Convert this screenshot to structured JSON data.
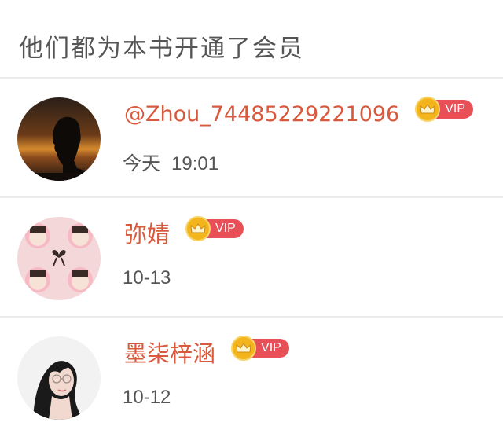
{
  "header": {
    "title": "他们都为本书开通了会员"
  },
  "vip_label": "VIP",
  "colors": {
    "name": "#d9593d",
    "vip_badge": "#e84f57",
    "crown": "#f3b51b",
    "divider": "#ececec"
  },
  "members": [
    {
      "name": "@Zhou_74485229221096",
      "time_day": "今天",
      "time": "19:01",
      "vip": true,
      "avatar_icon": "silhouette-sunset-avatar"
    },
    {
      "name": "弥婧",
      "time": "10-13",
      "vip": true,
      "avatar_icon": "collage-photo-avatar"
    },
    {
      "name": "墨柒梓涵",
      "time": "10-12",
      "vip": true,
      "avatar_icon": "portrait-photo-avatar"
    }
  ]
}
